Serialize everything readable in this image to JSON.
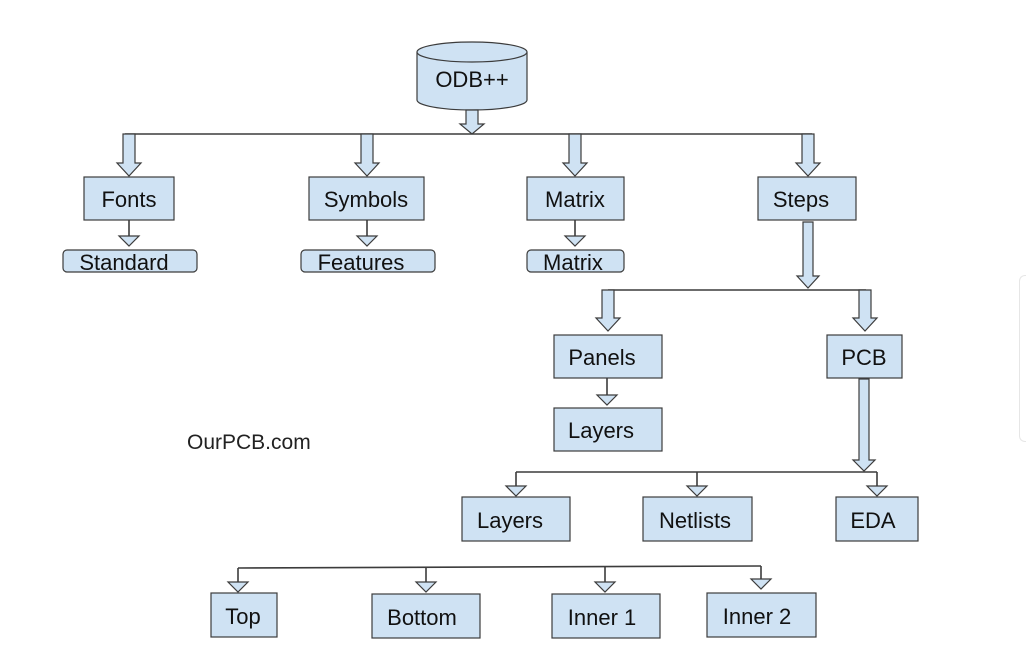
{
  "diagram": {
    "root": "ODB++",
    "level1": [
      "Fonts",
      "Symbols",
      "Matrix",
      "Steps"
    ],
    "level1_children": [
      "Standard",
      "Features",
      "Matrix"
    ],
    "steps_children": [
      "Panels",
      "PCB"
    ],
    "panels_child": "Layers",
    "pcb_children": [
      "Layers",
      "Netlists",
      "EDA"
    ],
    "layers_children": [
      "Top",
      "Bottom",
      "Inner 1",
      "Inner 2"
    ],
    "watermark": "OurPCB.com"
  },
  "colors": {
    "box_fill": "#cfe2f3",
    "stroke": "#3c3c3c"
  }
}
